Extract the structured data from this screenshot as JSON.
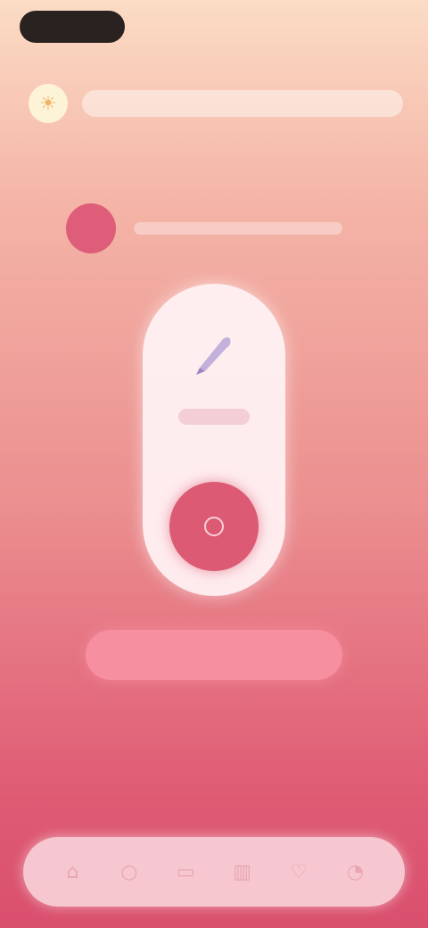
{
  "status_bar": {
    "time": "",
    "indicators": ""
  },
  "header": {
    "icon": "sun-icon",
    "title": ""
  },
  "info": {
    "icon": "info-icon",
    "text": ""
  },
  "recorder": {
    "icon": "pen-icon",
    "label": "",
    "record_icon": "record-icon"
  },
  "primary_button": {
    "label": ""
  },
  "tab_bar": {
    "items": [
      {
        "icon": "home-icon",
        "label": ""
      },
      {
        "icon": "search-icon",
        "label": ""
      },
      {
        "icon": "calendar-icon",
        "label": ""
      },
      {
        "icon": "chart-icon",
        "label": ""
      },
      {
        "icon": "heart-icon",
        "label": ""
      },
      {
        "icon": "user-icon",
        "label": ""
      }
    ]
  },
  "colors": {
    "accent": "#dc5a73",
    "button": "#f68fa0",
    "capsule": "#fff4f6",
    "header_icon": "#fdf3d6"
  }
}
